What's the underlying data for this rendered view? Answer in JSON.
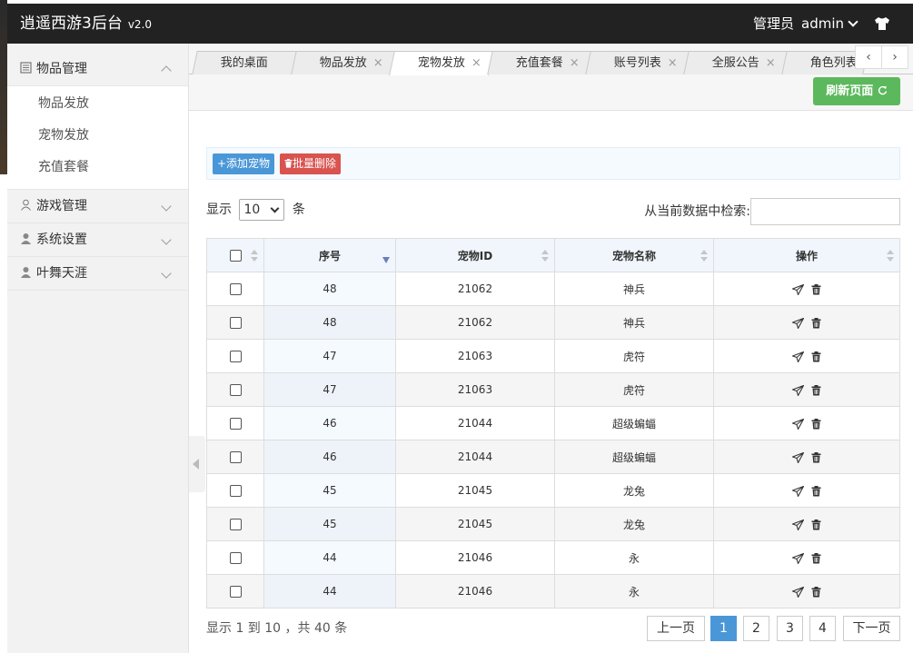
{
  "header": {
    "app_title": "逍遥西游3后台",
    "version": "v2.0",
    "role": "管理员",
    "username": "admin"
  },
  "sidebar": {
    "groups": [
      {
        "label": "物品管理",
        "items": [
          "物品发放",
          "宠物发放",
          "充值套餐"
        ]
      },
      {
        "label": "游戏管理"
      },
      {
        "label": "系统设置"
      },
      {
        "label": "叶舞天涯"
      }
    ]
  },
  "tabs": [
    {
      "label": "我的桌面"
    },
    {
      "label": "物品发放"
    },
    {
      "label": "宠物发放"
    },
    {
      "label": "充值套餐"
    },
    {
      "label": "账号列表"
    },
    {
      "label": "全服公告"
    },
    {
      "label": "角色列表"
    }
  ],
  "tab_close_glyph": "×",
  "tab_prev_glyph": "‹",
  "tab_next_glyph": "›",
  "refresh_label": "刷新页面",
  "toolbar": {
    "add_label": "+添加宠物",
    "batch_delete_label": "批量删除"
  },
  "length_menu": {
    "prefix": "显示",
    "value": "10",
    "suffix": "条"
  },
  "search": {
    "label": "从当前数据中检索:",
    "value": ""
  },
  "table": {
    "columns": [
      "序号",
      "宠物ID",
      "宠物名称",
      "操作"
    ],
    "rows": [
      {
        "no": "48",
        "id": "21062",
        "name": "神兵"
      },
      {
        "no": "48",
        "id": "21062",
        "name": "神兵"
      },
      {
        "no": "47",
        "id": "21063",
        "name": "虎符"
      },
      {
        "no": "47",
        "id": "21063",
        "name": "虎符"
      },
      {
        "no": "46",
        "id": "21044",
        "name": "超级蝙蝠"
      },
      {
        "no": "46",
        "id": "21044",
        "name": "超级蝙蝠"
      },
      {
        "no": "45",
        "id": "21045",
        "name": "龙兔"
      },
      {
        "no": "45",
        "id": "21045",
        "name": "龙兔"
      },
      {
        "no": "44",
        "id": "21046",
        "name": "永"
      },
      {
        "no": "44",
        "id": "21046",
        "name": "永"
      }
    ]
  },
  "info_text": "显示 1 到 10 ，共 40 条",
  "pagination": {
    "prev": "上一页",
    "pages": [
      "1",
      "2",
      "3",
      "4"
    ],
    "active": "1",
    "next": "下一页"
  },
  "colors": {
    "header_bg": "#222222",
    "primary": "#4a97d8",
    "danger": "#d9534f",
    "success": "#5cb85c"
  }
}
